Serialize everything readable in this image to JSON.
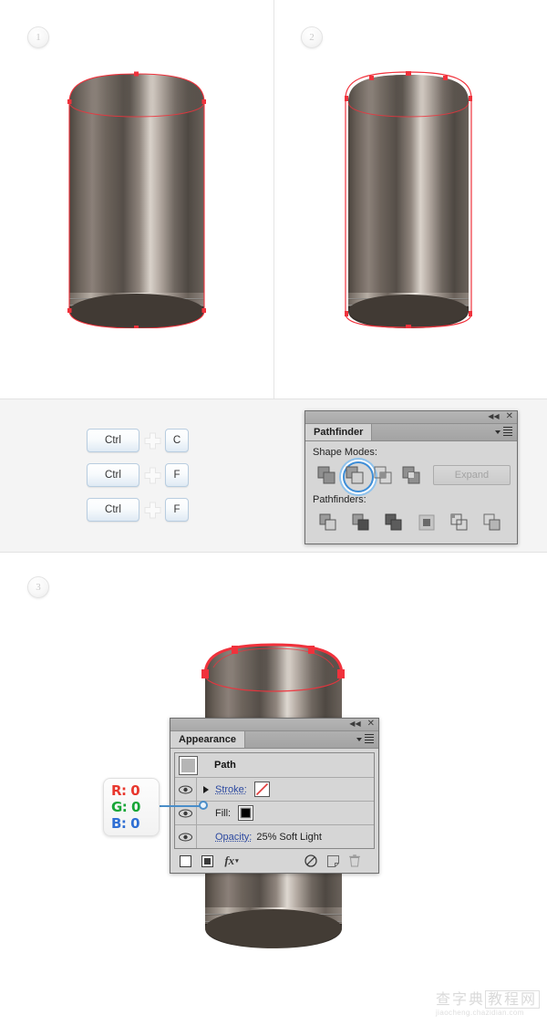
{
  "steps": [
    {
      "number": "1"
    },
    {
      "number": "2"
    },
    {
      "number": "3"
    }
  ],
  "shortcuts": {
    "plus_icon": "plus-icon",
    "rows": [
      {
        "modifier": "Ctrl",
        "key": "C"
      },
      {
        "modifier": "Ctrl",
        "key": "F"
      },
      {
        "modifier": "Ctrl",
        "key": "F"
      }
    ]
  },
  "pathfinder": {
    "tab_label": "Pathfinder",
    "collapse_icon": "collapse-icon",
    "close_icon": "close-icon",
    "menu_icon": "panel-menu-icon",
    "shape_modes_label": "Shape Modes:",
    "pathfinders_label": "Pathfinders:",
    "expand_label": "Expand",
    "shape_modes": [
      {
        "name": "unite-icon",
        "selected": false
      },
      {
        "name": "minus-front-icon",
        "selected": true
      },
      {
        "name": "intersect-icon",
        "selected": false
      },
      {
        "name": "exclude-icon",
        "selected": false
      }
    ],
    "pathfinders": [
      {
        "name": "divide-icon"
      },
      {
        "name": "trim-icon"
      },
      {
        "name": "merge-icon"
      },
      {
        "name": "crop-icon"
      },
      {
        "name": "outline-icon"
      },
      {
        "name": "minus-back-icon"
      }
    ]
  },
  "appearance": {
    "tab_label": "Appearance",
    "collapse_icon": "collapse-icon",
    "close_icon": "close-icon",
    "menu_icon": "panel-menu-icon",
    "object_label": "Path",
    "rows": [
      {
        "name": "stroke",
        "label": "Stroke:",
        "value": "",
        "swatch": "none"
      },
      {
        "name": "fill",
        "label": "Fill:",
        "value": "",
        "swatch": "black"
      },
      {
        "name": "opacity",
        "label": "Opacity:",
        "value": "25% Soft Light",
        "swatch": "none"
      }
    ],
    "toolbar": [
      {
        "name": "add-new-stroke-icon"
      },
      {
        "name": "add-new-fill-icon"
      },
      {
        "name": "add-new-effect-icon",
        "label": "fx"
      },
      {
        "name": "clear-appearance-icon"
      },
      {
        "name": "duplicate-item-icon"
      },
      {
        "name": "delete-item-icon"
      }
    ]
  },
  "rgb_callout": {
    "r": "R: 0",
    "g": "G: 0",
    "b": "B: 0",
    "r_color": "#e8372d",
    "g_color": "#17a637",
    "b_color": "#2f6fd4"
  },
  "artwork": {
    "path_stroke_color": "#f0323c",
    "anchor_color": "#f0323c",
    "metal_light": "#ded6cf",
    "metal_mid": "#7d746b",
    "metal_dark": "#3a342f"
  },
  "watermark": {
    "cn_left": "查字典",
    "cn_right": "教程网",
    "url": "jiaocheng.chazidian.com"
  }
}
